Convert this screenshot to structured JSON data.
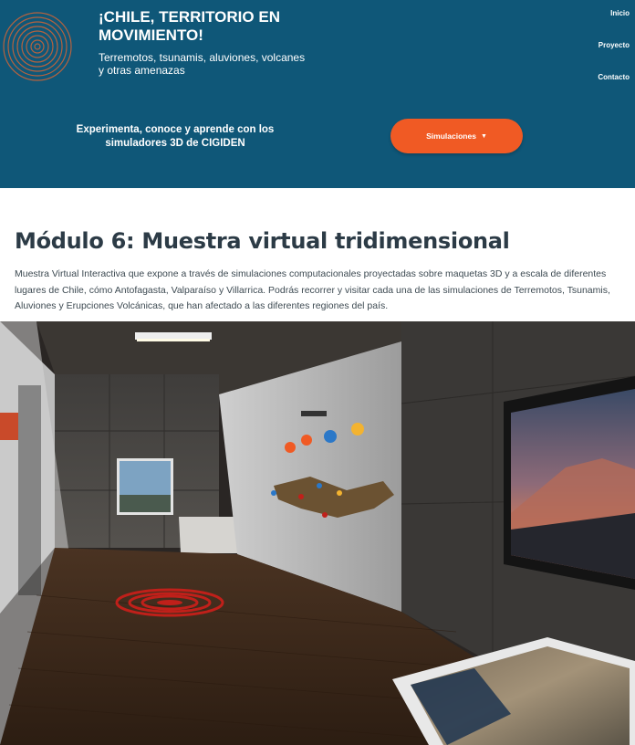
{
  "header": {
    "title": "¡CHILE, TERRITORIO EN MOVIMIENTO!",
    "subtitle": "Terremotos, tsunamis, aluviones, volcanes y otras amenazas",
    "tagline": "Experimenta, conoce y aprende con los simuladores 3D de CIGIDEN",
    "sim_button": "Simulaciones",
    "nav": [
      "Inicio",
      "Proyecto",
      "Contacto"
    ]
  },
  "main": {
    "heading": "Módulo 6: Muestra virtual tridimensional",
    "description": "Muestra Virtual Interactiva que expone a través de simulaciones computacionales proyectadas sobre maquetas 3D y a escala de diferentes lugares de Chile, cómo Antofagasta, Valparaíso y Villarrica. Podrás recorrer y visitar cada una de las simulaciones de Terremotos, Tsunamis, Aluviones y Erupciones Volcánicas, que han afectado a las diferentes regiones del país."
  },
  "colors": {
    "header_bg": "#0f5778",
    "accent": "#f05a24",
    "heading": "#2c3b46"
  }
}
